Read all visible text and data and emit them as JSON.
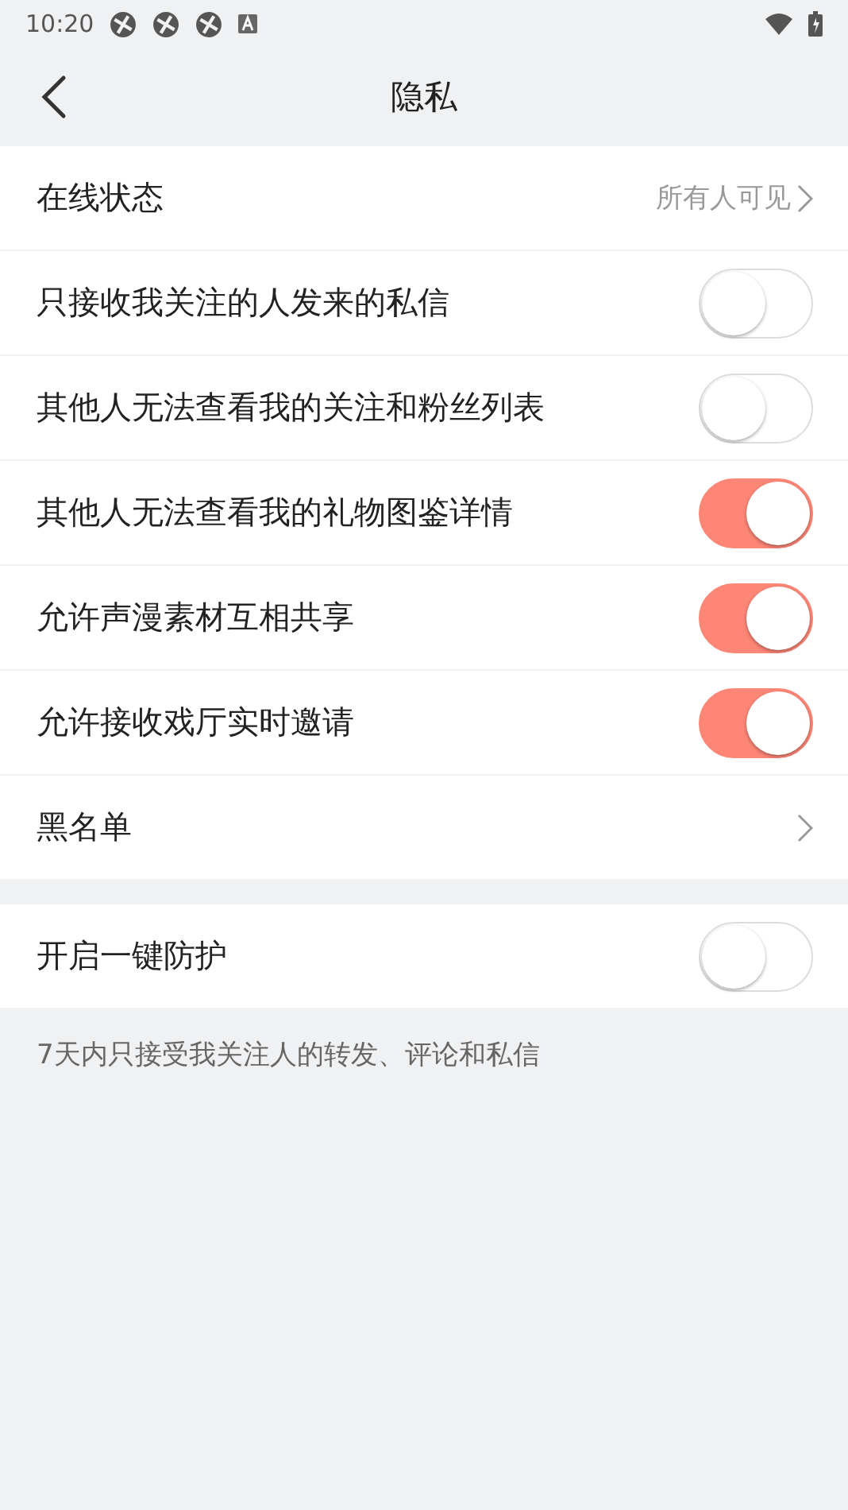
{
  "status_bar": {
    "time": "10:20"
  },
  "header": {
    "title": "隐私"
  },
  "groups": [
    {
      "rows": [
        {
          "kind": "link",
          "label": "在线状态",
          "value": "所有人可见"
        },
        {
          "kind": "toggle",
          "label": "只接收我关注的人发来的私信",
          "on": false
        },
        {
          "kind": "toggle",
          "label": "其他人无法查看我的关注和粉丝列表",
          "on": false
        },
        {
          "kind": "toggle",
          "label": "其他人无法查看我的礼物图鉴详情",
          "on": true
        },
        {
          "kind": "toggle",
          "label": "允许声漫素材互相共享",
          "on": true
        },
        {
          "kind": "toggle",
          "label": "允许接收戏厅实时邀请",
          "on": true
        },
        {
          "kind": "link",
          "label": "黑名单"
        }
      ]
    },
    {
      "rows": [
        {
          "kind": "toggle",
          "label": "开启一键防护",
          "on": false
        }
      ],
      "note": "7天内只接受我关注人的转发、评论和私信"
    }
  ]
}
